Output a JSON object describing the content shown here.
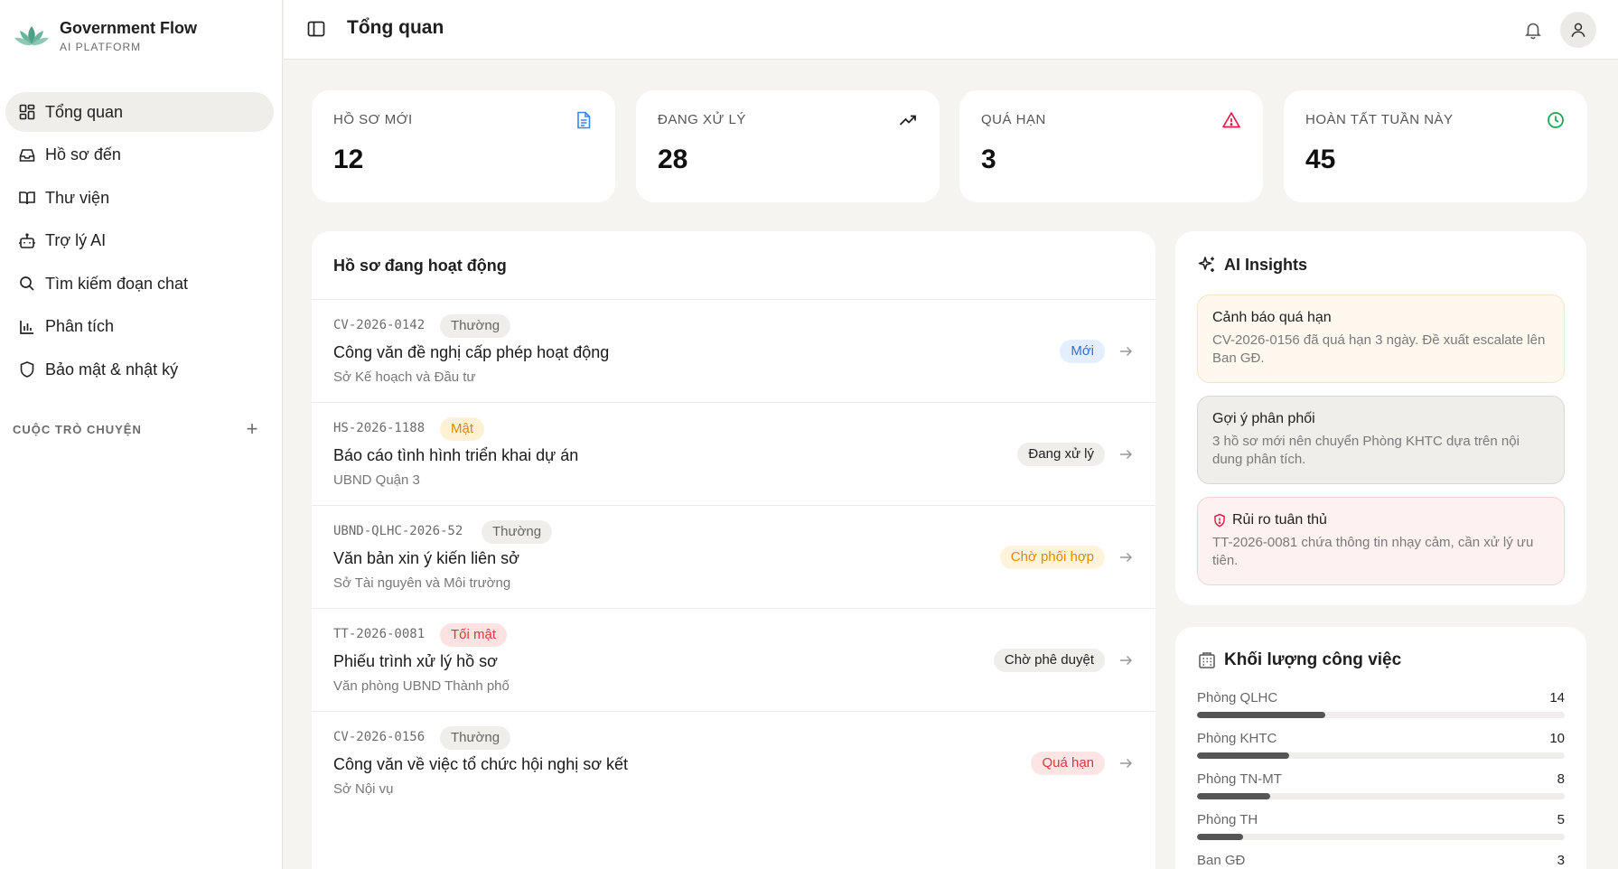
{
  "brand": {
    "title": "Government Flow",
    "subtitle": "AI PLATFORM"
  },
  "sidebar": {
    "items": [
      {
        "label": "Tổng quan",
        "icon": "grid-icon",
        "active": true
      },
      {
        "label": "Hồ sơ đến",
        "icon": "inbox-icon",
        "active": false
      },
      {
        "label": "Thư viện",
        "icon": "book-icon",
        "active": false
      },
      {
        "label": "Trợ lý AI",
        "icon": "robot-icon",
        "active": false
      },
      {
        "label": "Tìm kiếm đoạn chat",
        "icon": "search-icon",
        "active": false
      },
      {
        "label": "Phân tích",
        "icon": "bar-chart-icon",
        "active": false
      },
      {
        "label": "Bảo mật & nhật ký",
        "icon": "shield-icon",
        "active": false
      }
    ],
    "conversations_label": "CUỘC TRÒ CHUYỆN",
    "add_label": "+"
  },
  "header": {
    "title": "Tổng quan"
  },
  "stats": [
    {
      "label": "HỒ SƠ MỚI",
      "value": "12",
      "icon": "document-icon",
      "color": "#3b82f6"
    },
    {
      "label": "ĐANG XỬ LÝ",
      "value": "28",
      "icon": "trending-up-icon",
      "color": "#1f1f1f"
    },
    {
      "label": "QUÁ HẠN",
      "value": "3",
      "icon": "alert-triangle-icon",
      "color": "#e11d48"
    },
    {
      "label": "HOÀN TẤT TUẦN NÀY",
      "value": "45",
      "icon": "clock-icon",
      "color": "#16a34a"
    }
  ],
  "cases": {
    "title": "Hồ sơ đang hoạt động",
    "rows": [
      {
        "code": "CV-2026-0142",
        "tag": "Thường",
        "title": "Công văn đề nghị cấp phép hoạt động",
        "org": "Sở Kế hoạch và Đầu tư",
        "status": "Mới"
      },
      {
        "code": "HS-2026-1188",
        "tag": "Mật",
        "title": "Báo cáo tình hình triển khai dự án",
        "org": "UBND Quận 3",
        "status": "Đang xử lý"
      },
      {
        "code": "UBND-QLHC-2026-52",
        "tag": "Thường",
        "title": "Văn bản xin ý kiến liên sở",
        "org": "Sở Tài nguyên và Môi trường",
        "status": "Chờ phối hợp"
      },
      {
        "code": "TT-2026-0081",
        "tag": "Tối mật",
        "title": "Phiếu trình xử lý hồ sơ",
        "org": "Văn phòng UBND Thành phố",
        "status": "Chờ phê duyệt"
      },
      {
        "code": "CV-2026-0156",
        "tag": "Thường",
        "title": "Công văn về việc tổ chức hội nghị sơ kết",
        "org": "Sở Nội vụ",
        "status": "Quá hạn"
      }
    ]
  },
  "insights": {
    "title": "AI Insights",
    "cards": [
      {
        "heading": "Cảnh báo quá hạn",
        "body": "CV-2026-0156 đã quá hạn 3 ngày. Đề xuất escalate lên Ban GĐ."
      },
      {
        "heading": "Gợi ý phân phối",
        "body": "3 hồ sơ mới nên chuyển Phòng KHTC dựa trên nội dung phân tích."
      },
      {
        "heading": "Rủi ro tuân thủ",
        "body": "TT-2026-0081 chứa thông tin nhạy cảm, cần xử lý ưu tiên."
      }
    ]
  },
  "workload": {
    "title": "Khối lượng công việc",
    "max": 40,
    "rows": [
      {
        "name": "Phòng QLHC",
        "count": "14",
        "value": 14
      },
      {
        "name": "Phòng KHTC",
        "count": "10",
        "value": 10
      },
      {
        "name": "Phòng TN-MT",
        "count": "8",
        "value": 8
      },
      {
        "name": "Phòng TH",
        "count": "5",
        "value": 5
      },
      {
        "name": "Ban GĐ",
        "count": "3",
        "value": 3
      }
    ]
  }
}
